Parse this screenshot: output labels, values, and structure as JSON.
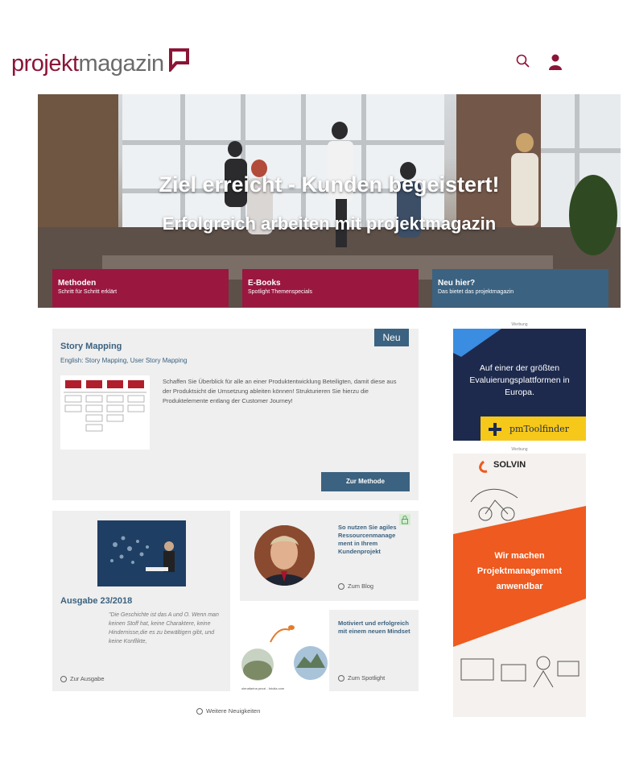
{
  "header": {
    "logo_part1": "projekt",
    "logo_part2": "magazin",
    "brand_color": "#8b1537",
    "search_icon": "search-icon",
    "user_icon": "user-icon"
  },
  "hero": {
    "title": "Ziel erreicht - Kunden begeistert!",
    "subtitle": "Erfolgreich arbeiten mit projektmagazin",
    "tiles": [
      {
        "title": "Methoden",
        "subtitle": "Schritt für Schritt erklärt",
        "color": "#9a1740"
      },
      {
        "title": "E-Books",
        "subtitle": "Spotlight Themenspecials",
        "color": "#9a1740"
      },
      {
        "title": "Neu hier?",
        "subtitle": "Das bietet das projektmagazin",
        "color": "#3b6280"
      }
    ]
  },
  "method_card": {
    "badge": "Neu",
    "title": "Story Mapping",
    "subtitle": "English: Story Mapping, User Story Mapping",
    "description": "Schaffen Sie Überblick für alle an einer Produktentwicklung Beteiligten, damit diese aus der Produktsicht die Umsetzung ableiten können! Strukturieren Sie hierzu die Produktelemente entlang der Customer Journey!",
    "button": "Zur Methode"
  },
  "issue_card": {
    "title": "Ausgabe 23/2018",
    "quote": "\"Die Geschichte ist das A und O. Wenn man keinen Stoff hat, keine Charaktere, keine Hindernisse,die es zu bewältigen gibt, und keine Konflikte,",
    "link": "Zur Ausgabe"
  },
  "blog_card": {
    "title": "So nutzen Sie agiles Ressourcenmanage ment in Ihrem Kundenprojekt",
    "link": "Zum Blog"
  },
  "spotlight_card": {
    "title": "Motiviert und erfolgreich mit einem neuen Mindset",
    "link": "Zum Spotlight",
    "image_credit": "olenafarina pezzi - fotolia.com"
  },
  "more_news": "Weitere Neuigkeiten",
  "ads": {
    "label": "Werbung",
    "ad1_text": "Auf einer der größten Evaluierungsplattformen in Europa.",
    "ad1_logo": "pmToolfinder",
    "ad2_logo": "SOLVIN",
    "ad2_text": "Wir machen Projektmanagement anwendbar"
  }
}
